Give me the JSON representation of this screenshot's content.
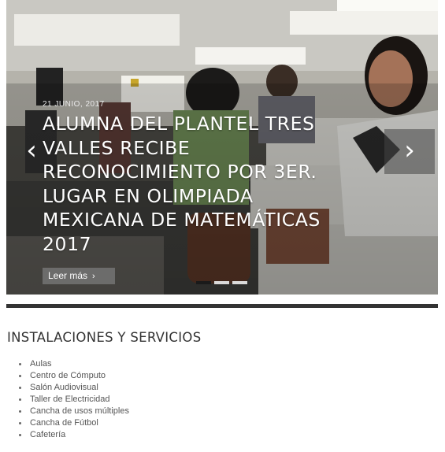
{
  "slider": {
    "date": "21 JUNIO, 2017",
    "title": "ALUMNA DEL PLANTEL TRES VALLES RECIBE RECONOCIMIENTO POR 3ER. LUGAR EN OLIMPIADA MEXICANA DE MATEMÁTICAS 2017",
    "read_more_label": "Leer más",
    "read_more_icon": "chevron-right-icon",
    "prev_icon": "chevron-left-icon",
    "next_icon": "chevron-right-icon",
    "slide_count": 3,
    "active_slide": 1
  },
  "section": {
    "title": "INSTALACIONES Y SERVICIOS",
    "items": [
      "Aulas",
      "Centro de Cómputo",
      "Salón Audiovisual",
      "Taller de Electricidad",
      "Cancha de usos múltiples",
      "Cancha de Fútbol",
      "Cafetería"
    ]
  }
}
